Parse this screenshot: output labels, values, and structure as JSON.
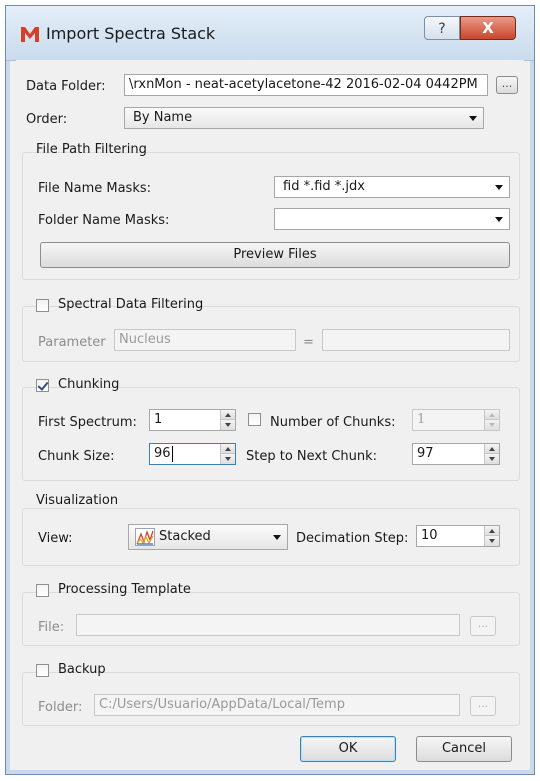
{
  "window": {
    "title": "Import Spectra Stack",
    "help_symbol": "?",
    "close_symbol": "X",
    "brand_color": "#d6402b"
  },
  "data_folder": {
    "label": "Data Folder:",
    "value": "\\rxnMon - neat-acetylacetone-42 2016-02-04 0442PM",
    "browse_label": "..."
  },
  "order": {
    "label": "Order:",
    "selected": "By Name"
  },
  "file_path_filtering": {
    "title": "File Path Filtering",
    "file_name_masks_label": "File Name Masks:",
    "file_name_masks_value": "fid *.fid *.jdx",
    "folder_name_masks_label": "Folder Name Masks:",
    "folder_name_masks_value": "",
    "preview_button": "Preview Files"
  },
  "spectral_data_filtering": {
    "title": "Spectral Data Filtering",
    "checked": false,
    "parameter_label": "Parameter",
    "parameter_value": "Nucleus",
    "equals": "=",
    "value": ""
  },
  "chunking": {
    "title": "Chunking",
    "checked": true,
    "first_spectrum_label": "First Spectrum:",
    "first_spectrum_value": "1",
    "number_of_chunks_label": "Number of Chunks:",
    "number_of_chunks_checked": false,
    "number_of_chunks_value": "1",
    "chunk_size_label": "Chunk Size:",
    "chunk_size_value": "96",
    "step_label": "Step to Next Chunk:",
    "step_value": "97"
  },
  "visualization": {
    "title": "Visualization",
    "view_label": "View:",
    "view_selected": "Stacked",
    "view_icon": "stacked-plot-icon",
    "decimation_label": "Decimation Step:",
    "decimation_value": "10"
  },
  "processing_template": {
    "title": "Processing Template",
    "checked": false,
    "file_label": "File:",
    "file_value": "",
    "browse_label": "..."
  },
  "backup": {
    "title": "Backup",
    "checked": false,
    "folder_label": "Folder:",
    "folder_value": "C:/Users/Usuario/AppData/Local/Temp",
    "browse_label": "..."
  },
  "buttons": {
    "ok": "OK",
    "cancel": "Cancel"
  }
}
